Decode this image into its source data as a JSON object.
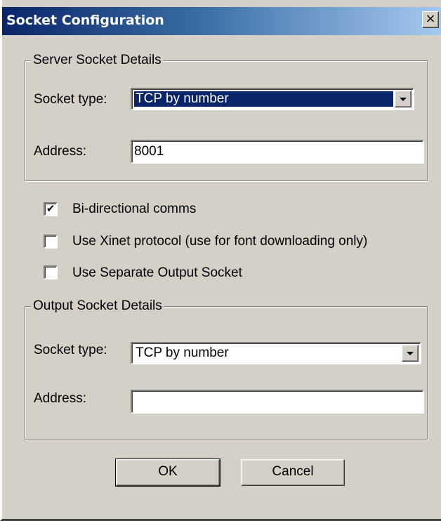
{
  "window": {
    "title": "Socket Configuration",
    "close_glyph": "×"
  },
  "server_group": {
    "legend": "Server Socket Details",
    "socket_type_label": "Socket type:",
    "socket_type_value": "TCP by number",
    "address_label": "Address:",
    "address_value": "8001"
  },
  "options": [
    {
      "label": "Bi-directional comms",
      "checked": true
    },
    {
      "label": "Use Xinet protocol (use for font downloading only)",
      "checked": false
    },
    {
      "label": "Use Separate Output Socket",
      "checked": false
    }
  ],
  "check_glyph": "✔",
  "output_group": {
    "legend": "Output Socket Details",
    "socket_type_label": "Socket type:",
    "socket_type_value": "TCP by number",
    "address_label": "Address:",
    "address_value": ""
  },
  "buttons": {
    "ok": "OK",
    "cancel": "Cancel"
  },
  "colors": {
    "title_bar_start": "#0a246a",
    "title_bar_end": "#a6caf0",
    "dialog_face": "#d4d0c8",
    "selection": "#0a246a"
  }
}
